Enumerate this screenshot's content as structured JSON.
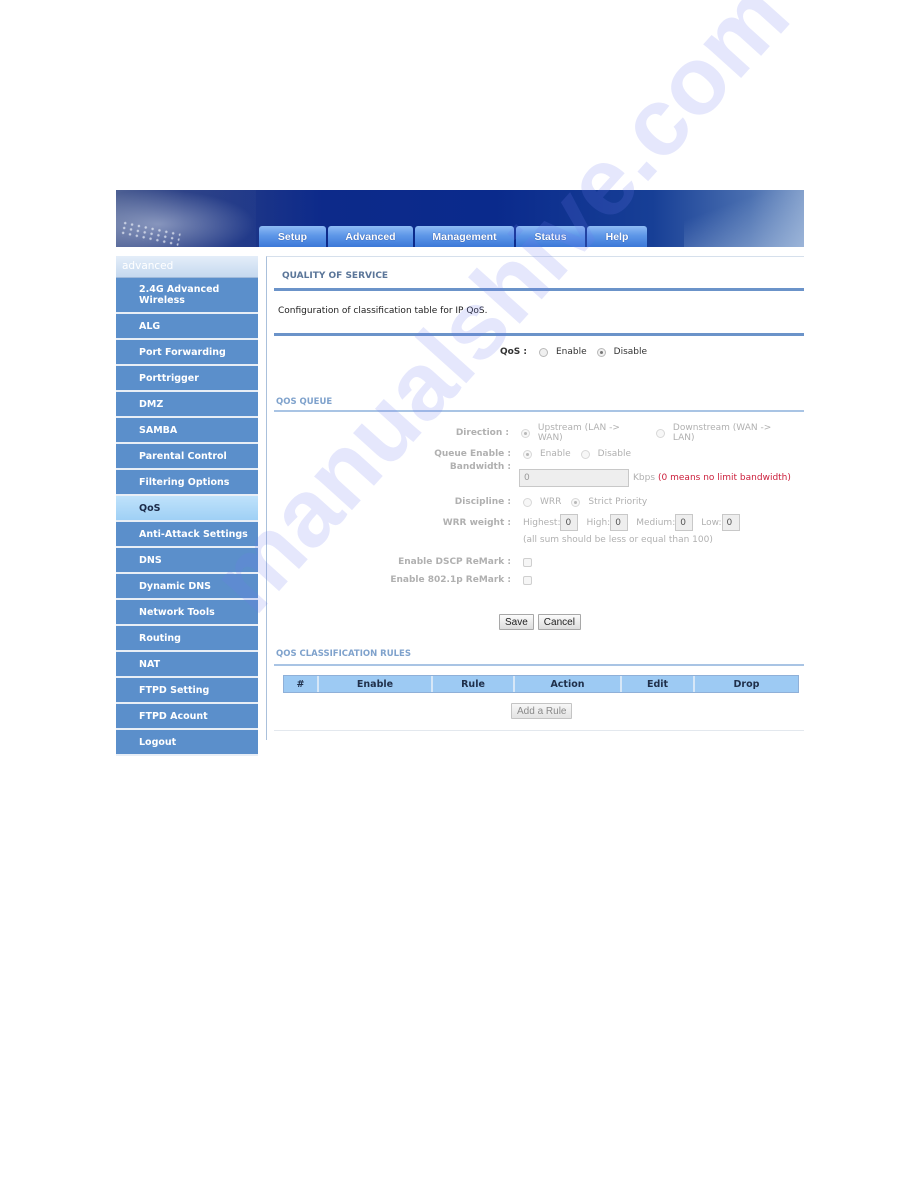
{
  "colors": {
    "tab_blue": "#5e97e8",
    "sidebar_item": "#5b8fcb",
    "sidebar_active": "#9fd0f5",
    "section_rule": "#6b93c9",
    "table_header": "#9dcaf3",
    "hint_red": "#cc1f3c"
  },
  "nav": {
    "tabs": [
      {
        "label": "Setup"
      },
      {
        "label": "Advanced"
      },
      {
        "label": "Management"
      },
      {
        "label": "Status"
      },
      {
        "label": "Help"
      }
    ]
  },
  "sidebar": {
    "header": "advanced",
    "active": "QoS",
    "items": [
      {
        "label": "2.4G Advanced Wireless"
      },
      {
        "label": "ALG"
      },
      {
        "label": "Port Forwarding"
      },
      {
        "label": "Porttrigger"
      },
      {
        "label": "DMZ"
      },
      {
        "label": "SAMBA"
      },
      {
        "label": "Parental Control"
      },
      {
        "label": "Filtering Options"
      },
      {
        "label": "QoS"
      },
      {
        "label": "Anti-Attack Settings"
      },
      {
        "label": "DNS"
      },
      {
        "label": "Dynamic DNS"
      },
      {
        "label": "Network Tools"
      },
      {
        "label": "Routing"
      },
      {
        "label": "NAT"
      },
      {
        "label": "FTPD Setting"
      },
      {
        "label": "FTPD Acount"
      },
      {
        "label": "Logout"
      }
    ]
  },
  "main": {
    "title": "QUALITY OF SERVICE",
    "description": "Configuration of classification table for IP QoS.",
    "qos": {
      "label": "QoS :",
      "options": [
        "Enable",
        "Disable"
      ],
      "selected": "Disable"
    },
    "queue": {
      "title": "QOS QUEUE",
      "direction": {
        "label": "Direction :",
        "options": [
          "Upstream (LAN -> WAN)",
          "Downstream (WAN -> LAN)"
        ],
        "selected": "Upstream (LAN -> WAN)"
      },
      "queue_enable": {
        "label": "Queue Enable :",
        "options": [
          "Enable",
          "Disable"
        ],
        "selected": "Enable"
      },
      "bandwidth": {
        "label": "Bandwidth :",
        "value": "0",
        "unit": "Kbps",
        "hint": "(0 means no limit bandwidth)"
      },
      "discipline": {
        "label": "Discipline :",
        "options": [
          "WRR",
          "Strict Priority"
        ],
        "selected": "Strict Priority"
      },
      "wrr_weight": {
        "label": "WRR weight :",
        "fields": [
          {
            "label": "Highest:",
            "value": "0"
          },
          {
            "label": "High:",
            "value": "0"
          },
          {
            "label": "Medium:",
            "value": "0"
          },
          {
            "label": "Low:",
            "value": "0"
          }
        ],
        "note": "(all sum should be less or equal than 100)"
      },
      "dscp_remark": {
        "label": "Enable DSCP ReMark :",
        "checked": false
      },
      "p8021_remark": {
        "label": "Enable 802.1p ReMark :",
        "checked": false
      },
      "save_label": "Save",
      "cancel_label": "Cancel"
    },
    "rules": {
      "title": "QOS CLASSIFICATION RULES",
      "columns": [
        "#",
        "Enable",
        "Rule",
        "Action",
        "Edit",
        "Drop"
      ],
      "rows": [],
      "add_label": "Add a Rule"
    }
  },
  "watermark": "manualshive.com"
}
